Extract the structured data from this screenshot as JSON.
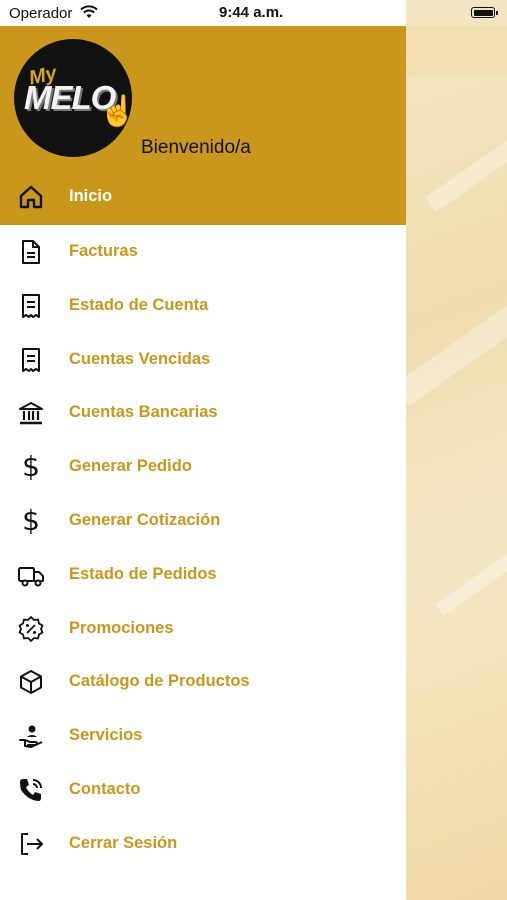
{
  "status_bar": {
    "carrier": "Operador",
    "time": "9:44 a.m."
  },
  "drawer": {
    "logo": {
      "small_text": "My",
      "big_text": "MELO"
    },
    "welcome": "Bienvenido/a",
    "accent_color": "#c9971c",
    "menu": [
      {
        "label": "Inicio",
        "icon": "home-icon",
        "active": true
      },
      {
        "label": "Facturas",
        "icon": "document-icon",
        "active": false
      },
      {
        "label": "Estado de Cuenta",
        "icon": "receipt-icon",
        "active": false
      },
      {
        "label": "Cuentas Vencidas",
        "icon": "receipt-icon",
        "active": false
      },
      {
        "label": "Cuentas Bancarias",
        "icon": "bank-icon",
        "active": false
      },
      {
        "label": "Generar Pedido",
        "icon": "dollar-icon",
        "active": false
      },
      {
        "label": "Generar Cotización",
        "icon": "dollar-icon",
        "active": false
      },
      {
        "label": "Estado de Pedidos",
        "icon": "truck-icon",
        "active": false
      },
      {
        "label": "Promociones",
        "icon": "discount-badge-icon",
        "active": false
      },
      {
        "label": "Catálogo de Productos",
        "icon": "box-icon",
        "active": false
      },
      {
        "label": "Servicios",
        "icon": "service-hand-icon",
        "active": false
      },
      {
        "label": "Contacto",
        "icon": "phone-call-icon",
        "active": false
      },
      {
        "label": "Cerrar Sesión",
        "icon": "logout-icon",
        "active": false
      }
    ]
  }
}
